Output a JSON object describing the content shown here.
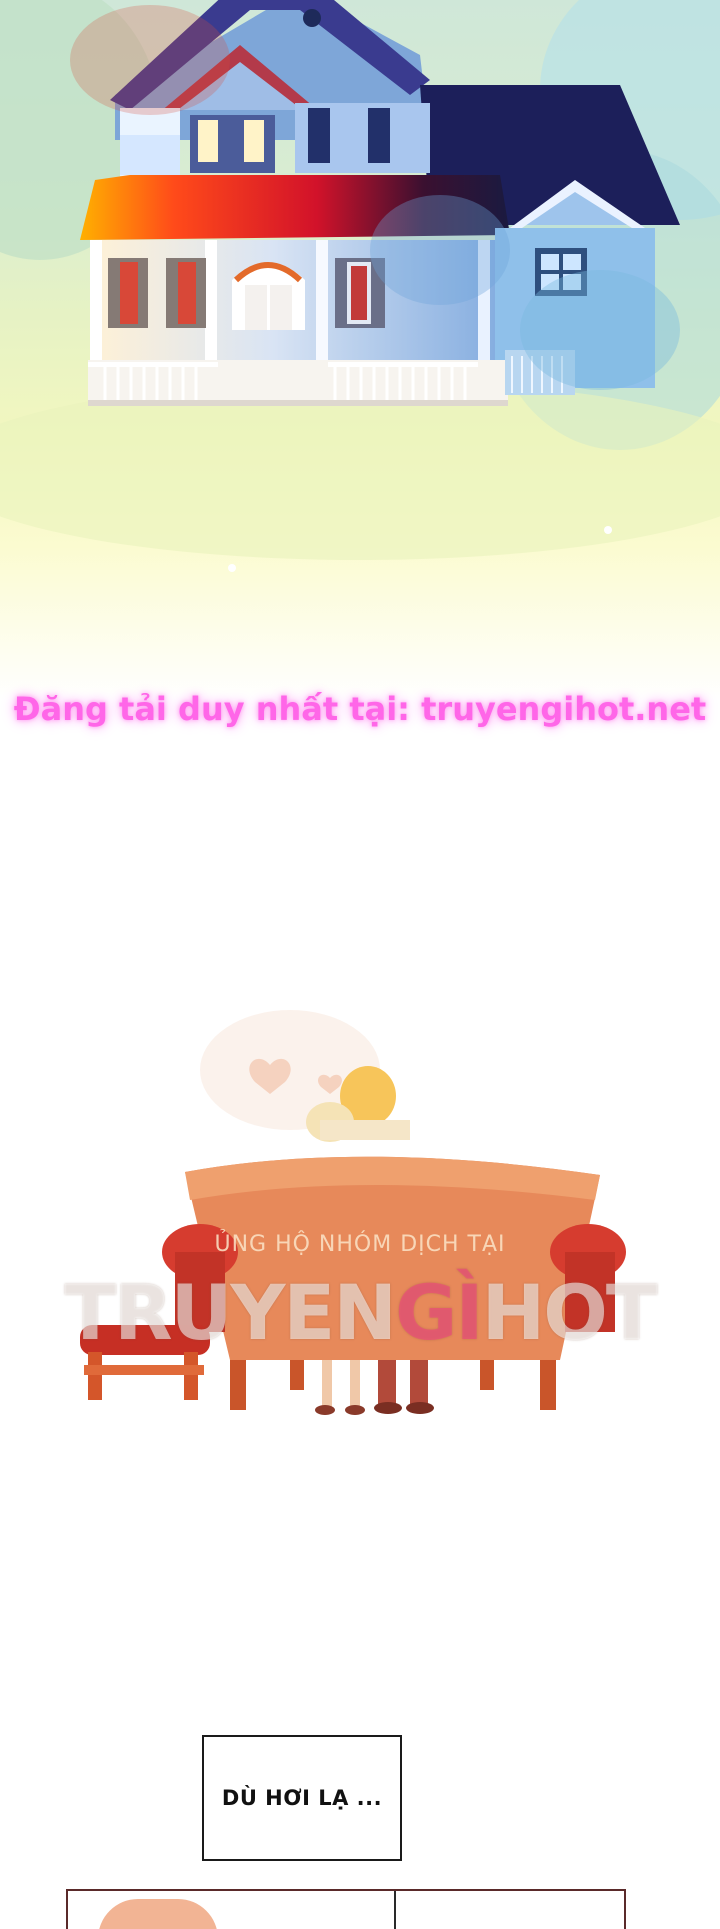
{
  "banner": {
    "text": "Đăng tải duy nhất tại: truyengihot.net"
  },
  "watermark": {
    "small": "ỦNG HỘ NHÓM DỊCH TẠI",
    "big_prefix": "TRUYEN",
    "big_accent": "GÌ",
    "big_suffix": "HOT"
  },
  "speech": {
    "text": "DÙ HƠI LẠ ..."
  }
}
